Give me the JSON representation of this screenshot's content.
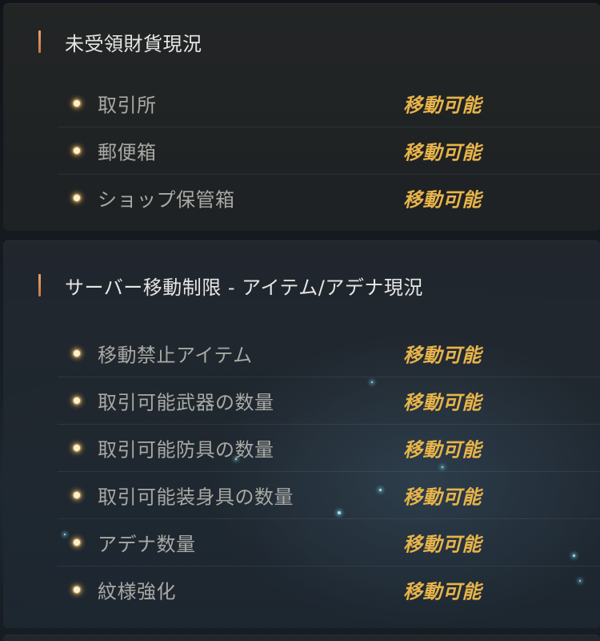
{
  "sections": [
    {
      "title": "未受領財貨現況",
      "rows": [
        {
          "label": "取引所",
          "status": "移動可能"
        },
        {
          "label": "郵便箱",
          "status": "移動可能"
        },
        {
          "label": "ショップ保管箱",
          "status": "移動可能"
        }
      ]
    },
    {
      "title": "サーバー移動制限 - アイテム/アデナ現況",
      "rows": [
        {
          "label": "移動禁止アイテム",
          "status": "移動可能"
        },
        {
          "label": "取引可能武器の数量",
          "status": "移動可能"
        },
        {
          "label": "取引可能防具の数量",
          "status": "移動可能"
        },
        {
          "label": "取引可能装身具の数量",
          "status": "移動可能"
        },
        {
          "label": "アデナ数量",
          "status": "移動可能"
        },
        {
          "label": "紋様強化",
          "status": "移動可能"
        }
      ]
    }
  ],
  "colors": {
    "header_accent": "#e8a36a",
    "status_text": "#e8b44a",
    "label_text": "#a9a9a4",
    "title_text": "#e6e6e4"
  }
}
